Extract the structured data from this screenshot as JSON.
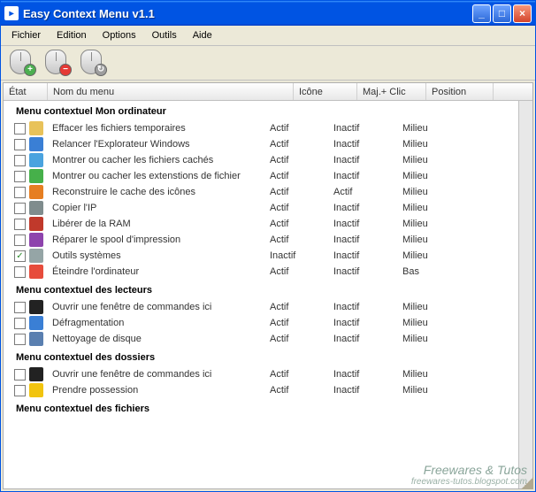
{
  "window": {
    "title": "Easy Context Menu v1.1"
  },
  "menubar": [
    "Fichier",
    "Edition",
    "Options",
    "Outils",
    "Aide"
  ],
  "toolbar": [
    {
      "name": "mouse-add-button",
      "badge": "+",
      "badgeClass": "badge-add"
    },
    {
      "name": "mouse-remove-button",
      "badge": "−",
      "badgeClass": "badge-del"
    },
    {
      "name": "mouse-refresh-button",
      "badge": "↻",
      "badgeClass": "badge-ref"
    }
  ],
  "columns": {
    "etat": "État",
    "nom": "Nom du menu",
    "icone": "Icône",
    "maj": "Maj.+ Clic",
    "position": "Position"
  },
  "groups": [
    {
      "title": "Menu contextuel Mon ordinateur",
      "items": [
        {
          "checked": false,
          "iconColor": "#e8c25a",
          "label": "Effacer les fichiers temporaires",
          "icone": "Actif",
          "maj": "Inactif",
          "pos": "Milieu"
        },
        {
          "checked": false,
          "iconColor": "#3a7fd5",
          "label": "Relancer l'Explorateur Windows",
          "icone": "Actif",
          "maj": "Inactif",
          "pos": "Milieu"
        },
        {
          "checked": false,
          "iconColor": "#4aa3df",
          "label": "Montrer ou cacher les fichiers cachés",
          "icone": "Actif",
          "maj": "Inactif",
          "pos": "Milieu"
        },
        {
          "checked": false,
          "iconColor": "#46b04a",
          "label": "Montrer ou cacher les extenstions de fichier",
          "icone": "Actif",
          "maj": "Inactif",
          "pos": "Milieu"
        },
        {
          "checked": false,
          "iconColor": "#e67e22",
          "label": "Reconstruire le cache des icônes",
          "icone": "Actif",
          "maj": "Actif",
          "pos": "Milieu"
        },
        {
          "checked": false,
          "iconColor": "#7f8c8d",
          "label": "Copier l'IP",
          "icone": "Actif",
          "maj": "Inactif",
          "pos": "Milieu"
        },
        {
          "checked": false,
          "iconColor": "#c0392b",
          "label": "Libérer de la RAM",
          "icone": "Actif",
          "maj": "Inactif",
          "pos": "Milieu"
        },
        {
          "checked": false,
          "iconColor": "#8e44ad",
          "label": "Réparer le spool d'impression",
          "icone": "Actif",
          "maj": "Inactif",
          "pos": "Milieu"
        },
        {
          "checked": true,
          "iconColor": "#95a5a6",
          "label": "Outils systèmes",
          "icone": "Inactif",
          "maj": "Inactif",
          "pos": "Milieu"
        },
        {
          "checked": false,
          "iconColor": "#e74c3c",
          "label": "Éteindre l'ordinateur",
          "icone": "Actif",
          "maj": "Inactif",
          "pos": "Bas"
        }
      ]
    },
    {
      "title": "Menu contextuel des lecteurs",
      "items": [
        {
          "checked": false,
          "iconColor": "#222",
          "label": "Ouvrir une fenêtre de commandes ici",
          "icone": "Actif",
          "maj": "Inactif",
          "pos": "Milieu"
        },
        {
          "checked": false,
          "iconColor": "#3a7fd5",
          "label": "Défragmentation",
          "icone": "Actif",
          "maj": "Inactif",
          "pos": "Milieu"
        },
        {
          "checked": false,
          "iconColor": "#5a7fb0",
          "label": "Nettoyage de disque",
          "icone": "Actif",
          "maj": "Inactif",
          "pos": "Milieu"
        }
      ]
    },
    {
      "title": "Menu contextuel des dossiers",
      "items": [
        {
          "checked": false,
          "iconColor": "#222",
          "label": "Ouvrir une fenêtre de commandes ici",
          "icone": "Actif",
          "maj": "Inactif",
          "pos": "Milieu"
        },
        {
          "checked": false,
          "iconColor": "#f1c40f",
          "label": "Prendre possession",
          "icone": "Actif",
          "maj": "Inactif",
          "pos": "Milieu"
        }
      ]
    },
    {
      "title": "Menu contextuel des fichiers",
      "items": []
    }
  ],
  "watermark": {
    "main": "Freewares & Tutos",
    "sub": "freewares-tutos.blogspot.com"
  }
}
